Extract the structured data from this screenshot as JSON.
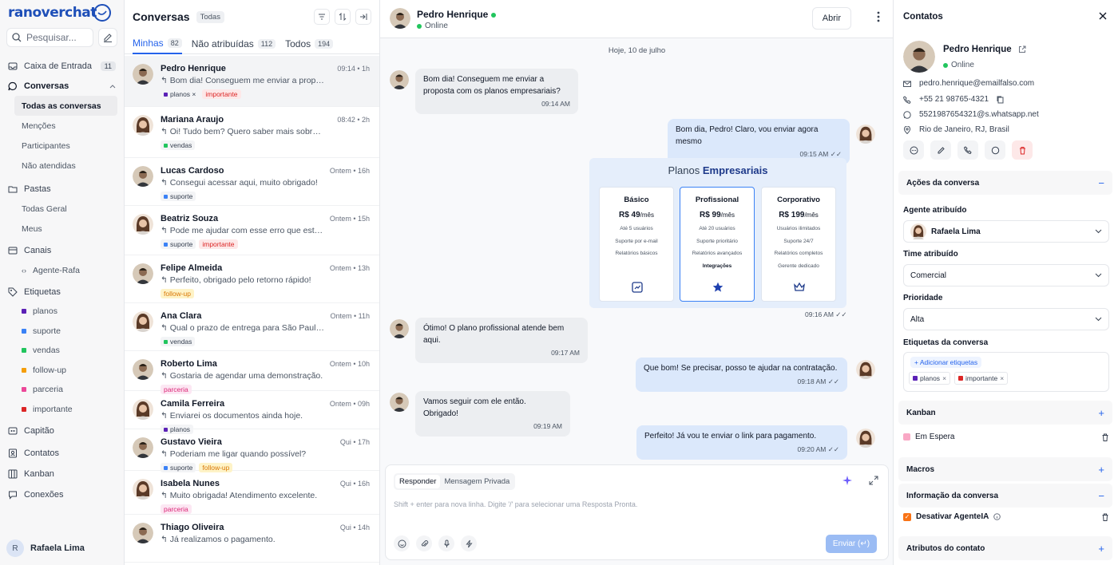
{
  "brand": {
    "logo_text": "ranoverchat"
  },
  "sidebar": {
    "search_placeholder": "Pesquisar...",
    "inbox": {
      "label": "Caixa de Entrada",
      "count": "11"
    },
    "conversations": {
      "label": "Conversas",
      "sub": [
        "Todas as conversas",
        "Menções",
        "Participantes",
        "Não atendidas"
      ]
    },
    "folders": {
      "label": "Pastas",
      "sub": [
        "Todas Geral",
        "Meus"
      ]
    },
    "channels": {
      "label": "Canais",
      "sub": [
        "Agente-Rafa"
      ]
    },
    "labels": {
      "label": "Etiquetas",
      "sub": [
        {
          "name": "planos",
          "color": "#5b21b6"
        },
        {
          "name": "suporte",
          "color": "#3b82f6"
        },
        {
          "name": "vendas",
          "color": "#22c55e"
        },
        {
          "name": "follow-up",
          "color": "#f59e0b"
        },
        {
          "name": "parceria",
          "color": "#ec4899"
        },
        {
          "name": "importante",
          "color": "#dc2626"
        }
      ]
    },
    "bottom": [
      "Capitão",
      "Contatos",
      "Kanban",
      "Conexões"
    ],
    "user": {
      "initial": "R",
      "name": "Rafaela Lima"
    }
  },
  "conv_list": {
    "title": "Conversas",
    "filter_pill": "Todas",
    "tabs": [
      {
        "label": "Minhas",
        "count": "82"
      },
      {
        "label": "Não atribuídas",
        "count": "112"
      },
      {
        "label": "Todos",
        "count": "194"
      }
    ],
    "items": [
      {
        "name": "Pedro Henrique",
        "time": "09:14 • 1h",
        "preview": "↰ Bom dia! Conseguem me enviar a proposta...",
        "tags": [
          "planos ×",
          "importante"
        ],
        "gender": "m"
      },
      {
        "name": "Mariana Araujo",
        "time": "08:42 • 2h",
        "preview": "↰ Oi! Tudo bem? Quero saber mais sobre o...",
        "tags": [
          "vendas"
        ],
        "gender": "f"
      },
      {
        "name": "Lucas Cardoso",
        "time": "Ontem • 16h",
        "preview": "↰ Consegui acessar aqui, muito obrigado!",
        "tags": [
          "suporte"
        ],
        "gender": "m"
      },
      {
        "name": "Beatriz Souza",
        "time": "Ontem • 15h",
        "preview": "↰ Pode me ajudar com esse erro que está aco...",
        "tags": [
          "suporte",
          "importante"
        ],
        "gender": "f"
      },
      {
        "name": "Felipe Almeida",
        "time": "Ontem • 13h",
        "preview": "↰ Perfeito, obrigado pelo retorno rápido!",
        "tags": [
          "follow-up"
        ],
        "gender": "m"
      },
      {
        "name": "Ana Clara",
        "time": "Ontem • 11h",
        "preview": "↰ Qual o prazo de entrega para São Paulo?",
        "tags": [
          "vendas"
        ],
        "gender": "f"
      },
      {
        "name": "Roberto Lima",
        "time": "Ontem • 10h",
        "preview": "↰ Gostaria de agendar uma demonstração.",
        "tags": [
          "parceria"
        ],
        "gender": "m"
      },
      {
        "name": "Camila Ferreira",
        "time": "Ontem • 09h",
        "preview": "↰ Enviarei os documentos ainda hoje.",
        "tags": [
          "planos"
        ],
        "gender": "f"
      },
      {
        "name": "Gustavo Vieira",
        "time": "Qui • 17h",
        "preview": "↰ Poderiam me ligar quando possível?",
        "tags": [
          "suporte",
          "follow-up"
        ],
        "gender": "m"
      },
      {
        "name": "Isabela Nunes",
        "time": "Qui • 16h",
        "preview": "↰ Muito obrigada! Atendimento excelente.",
        "tags": [
          "parceria"
        ],
        "gender": "f"
      },
      {
        "name": "Thiago Oliveira",
        "time": "Qui • 14h",
        "preview": "↰ Já realizamos o pagamento.",
        "tags": [],
        "gender": "m"
      }
    ]
  },
  "chat": {
    "contact_name": "Pedro Henrique",
    "status": "Online",
    "open_button": "Abrir",
    "date_separator": "Hoje, 10 de julho",
    "messages": [
      {
        "dir": "in",
        "text": "Bom dia! Conseguem me enviar a proposta com os planos empresariais?",
        "time": "09:14 AM"
      },
      {
        "dir": "out",
        "text": "Bom dia, Pedro! Claro, vou enviar agora mesmo",
        "time": "09:15 AM"
      },
      {
        "dir": "in",
        "text": "Ótimo! O plano profissional atende bem aqui.",
        "time": "09:17 AM"
      },
      {
        "dir": "out",
        "text": "Que bom! Se precisar, posso te ajudar na contratação.",
        "time": "09:18 AM"
      },
      {
        "dir": "in",
        "text": "Vamos seguir com ele então. Obrigado!",
        "time": "09:19 AM"
      },
      {
        "dir": "out",
        "text": "Perfeito! Já vou te enviar o link para pagamento.",
        "time": "09:20 AM"
      }
    ],
    "promo": {
      "title_a": "Planos ",
      "title_b": "Empresariais",
      "time": "09:16 AM",
      "plans": [
        {
          "name": "Básico",
          "price": "R$ 49",
          "per": "/mês",
          "features": [
            "Até 5 usuários",
            "Suporte por e-mail",
            "Relatórios básicos"
          ]
        },
        {
          "name": "Profissional",
          "price": "R$ 99",
          "per": "/mês",
          "features": [
            "Até 20 usuários",
            "Suporte prioritário",
            "Relatórios avançados",
            "Integrações"
          ]
        },
        {
          "name": "Corporativo",
          "price": "R$ 199",
          "per": "/mês",
          "features": [
            "Usuários ilimitados",
            "Suporte 24/7",
            "Relatórios completos",
            "Gerente dedicado"
          ]
        }
      ]
    },
    "composer": {
      "tab_reply": "Responder",
      "tab_private": "Mensagem Privada",
      "placeholder": "Shift + enter para nova linha. Digite '/' para selecionar uma Resposta Pronta.",
      "send": "Enviar (↵)"
    }
  },
  "contacts": {
    "title": "Contatos",
    "name": "Pedro Henrique",
    "status": "Online",
    "email": "pedro.henrique@emailfalso.com",
    "phone": "+55 21 98765-4321",
    "whatsapp": "5521987654321@s.whatsapp.net",
    "location": "Rio de Janeiro, RJ, Brasil",
    "actions_section": "Ações da conversa",
    "agent_label": "Agente atribuído",
    "agent_value": "Rafaela Lima",
    "team_label": "Time atribuído",
    "team_value": "Comercial",
    "priority_label": "Prioridade",
    "priority_value": "Alta",
    "labels_label": "Etiquetas da conversa",
    "add_labels": "+ Adicionar etiquetas",
    "conv_tags": [
      {
        "name": "planos",
        "color": "#5b21b6"
      },
      {
        "name": "importante",
        "color": "#dc2626"
      }
    ],
    "kanban_section": "Kanban",
    "kanban_item": "Em Espera",
    "macros_section": "Macros",
    "info_section": "Informação da conversa",
    "disable_ai": "Desativar AgenteIA",
    "attributes_section": "Atributos do contato"
  }
}
